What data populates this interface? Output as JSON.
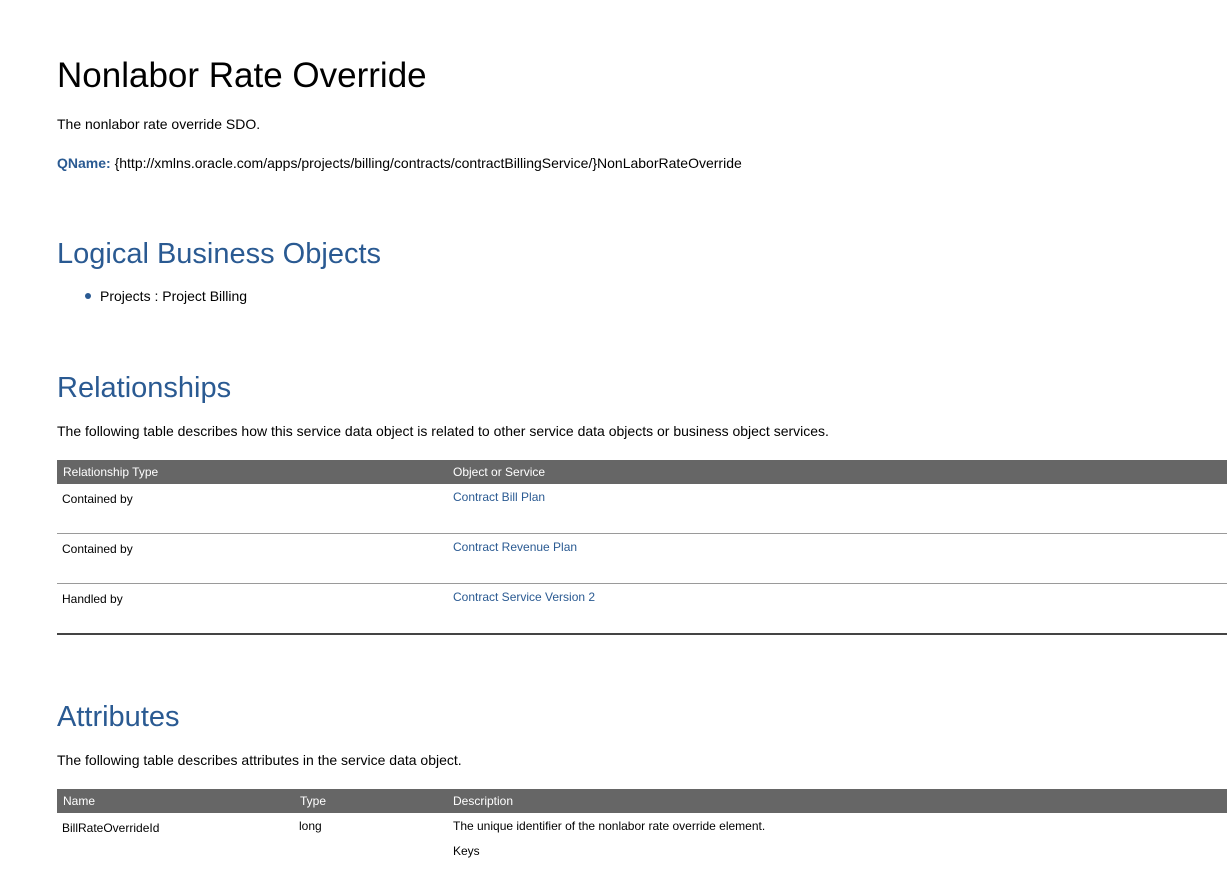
{
  "title": "Nonlabor Rate Override",
  "description": "The nonlabor rate override SDO.",
  "qname": {
    "label": "QName:",
    "value": "{http://xmlns.oracle.com/apps/projects/billing/contracts/contractBillingService/}NonLaborRateOverride"
  },
  "logical_business_objects": {
    "heading": "Logical Business Objects",
    "items": [
      "Projects : Project Billing"
    ]
  },
  "relationships": {
    "heading": "Relationships",
    "intro": "The following table describes how this service data object is related to other service data objects or business object services.",
    "columns": [
      "Relationship Type",
      "Object or Service"
    ],
    "rows": [
      {
        "type": "Contained by",
        "object": "Contract Bill Plan"
      },
      {
        "type": "Contained by",
        "object": "Contract Revenue Plan"
      },
      {
        "type": "Handled by",
        "object": "Contract Service Version 2"
      }
    ]
  },
  "attributes": {
    "heading": "Attributes",
    "intro": "The following table describes attributes in the service data object.",
    "columns": [
      "Name",
      "Type",
      "Description"
    ],
    "rows": [
      {
        "name": "BillRateOverrideId",
        "type": "long",
        "description": "The unique identifier of the nonlabor rate override element.",
        "extra": "Keys"
      }
    ]
  }
}
